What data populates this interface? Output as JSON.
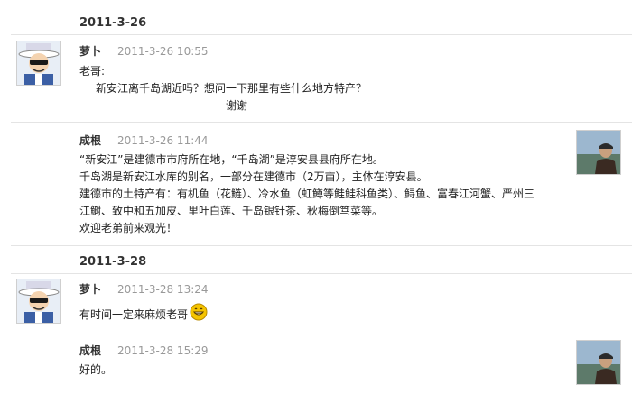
{
  "threads": [
    {
      "date": "2011-3-26",
      "question": {
        "author": "萝卜",
        "time": "2011-3-26 10:55",
        "lines": [
          "老哥:",
          "新安江离千岛湖近吗？想问一下那里有些什么地方特产？",
          "谢谢"
        ]
      },
      "reply": {
        "author": "成根",
        "time": "2011-3-26 11:44",
        "lines": [
          "“新安江”是建德市市府所在地，“千岛湖”是淳安县县府所在地。",
          "千岛湖是新安江水库的别名，一部分在建德市（2万亩），主体在淳安县。",
          "建德市的土特产有：有机鱼（花鲢）、冷水鱼（虹鳟等鲑鲑科鱼类）、鲟鱼、富春江河蟹、严州三",
          "江鲥、致中和五加皮、里叶白莲、千岛银针茶、秋梅倒笃菜等。",
          "欢迎老弟前来观光！"
        ]
      }
    },
    {
      "date": "2011-3-28",
      "question": {
        "author": "萝卜",
        "time": "2011-3-28 13:24",
        "lines": [
          "有时间一定来麻烦老哥"
        ]
      },
      "reply": {
        "author": "成根",
        "time": "2011-3-28 15:29",
        "lines": [
          "好的。"
        ]
      }
    }
  ],
  "icons": {
    "cartoon_avatar": "cartoon-avatar-icon",
    "photo_avatar": "photo-avatar-icon",
    "smiley": "grinning-smiley-icon"
  }
}
